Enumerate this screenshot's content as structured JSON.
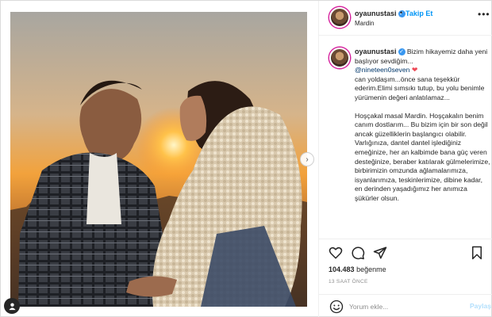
{
  "post": {
    "username": "oyaunustasi",
    "verified_badge": "✓",
    "follow_label": "Takip Et",
    "separator": "•",
    "location": "Mardin",
    "more_icon": "more-dots-icon"
  },
  "caption": {
    "username": "oyaunustasi",
    "line1": "Bizim hikayemiz daha yeni başlıyor sevdiğim...",
    "mention": "@nineteen0seven",
    "heart": "❤",
    "line2": "can yoldaşım...önce sana teşekkür ederim.Elimi sımsıkı tutup, bu yolu benimle yürümenin değeri anlatılamaz...",
    "para2": "Hoşçakal masal Mardin. Hoşçakalın benim canım dostlarım... Bu bizim için bir son değil ancak güzelliklerin başlangıcı olabilir. Varlığınıza, dantel dantel işlediğiniz emeğinize, her an kalbimde bana güç veren desteğinize, beraber katılarak gülmelerimize, birbirimizin omzunda ağlamalarımıza, isyanlarımıza, teskinlerimize, dibine kadar, en derinden yaşadığımız her anımıza şükürler olsun."
  },
  "actions": {
    "like_icon": "heart-icon",
    "comment_icon": "comment-icon",
    "share_icon": "share-icon",
    "save_icon": "bookmark-icon",
    "likes_count": "104.483",
    "likes_label": "beğenme",
    "timestamp": "13 SAAT ÖNCE"
  },
  "comment": {
    "placeholder": "Yorum ekle...",
    "post_label": "Paylaş"
  },
  "colors": {
    "accent_blue": "#0095f6",
    "post_disabled": "#b2dffc",
    "heart_red": "#ed4956",
    "mention": "#00376b"
  }
}
